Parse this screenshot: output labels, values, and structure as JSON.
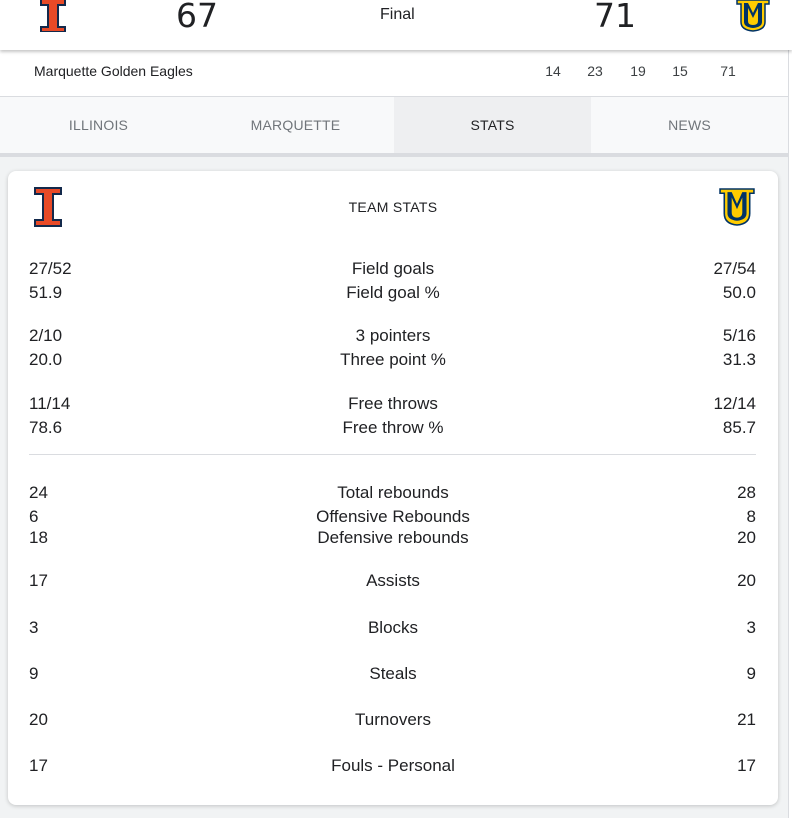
{
  "scoreboard": {
    "home_score": "67",
    "status": "Final",
    "away_score": "71"
  },
  "linescore": {
    "team": "Marquette Golden Eagles",
    "quarters": [
      "14",
      "23",
      "19",
      "15"
    ],
    "total": "71"
  },
  "tabs": [
    {
      "label": "ILLINOIS",
      "active": false
    },
    {
      "label": "MARQUETTE",
      "active": false
    },
    {
      "label": "STATS",
      "active": true
    },
    {
      "label": "NEWS",
      "active": false
    }
  ],
  "team_stats": {
    "title": "TEAM STATS",
    "rows": [
      {
        "label": "Field goals",
        "home": "27/52",
        "away": "27/54"
      },
      {
        "label": "Field goal %",
        "home": "51.9",
        "away": "50.0"
      },
      {
        "label": "3 pointers",
        "home": "2/10",
        "away": "5/16"
      },
      {
        "label": "Three point %",
        "home": "20.0",
        "away": "31.3"
      },
      {
        "label": "Free throws",
        "home": "11/14",
        "away": "12/14"
      },
      {
        "label": "Free throw %",
        "home": "78.6",
        "away": "85.7"
      },
      {
        "label": "Total rebounds",
        "home": "24",
        "away": "28"
      },
      {
        "label": "Offensive Rebounds",
        "home": "6",
        "away": "8"
      },
      {
        "label": "Defensive rebounds",
        "home": "18",
        "away": "20"
      },
      {
        "label": "Assists",
        "home": "17",
        "away": "20"
      },
      {
        "label": "Blocks",
        "home": "3",
        "away": "3"
      },
      {
        "label": "Steals",
        "home": "9",
        "away": "9"
      },
      {
        "label": "Turnovers",
        "home": "20",
        "away": "21"
      },
      {
        "label": "Fouls - Personal",
        "home": "17",
        "away": "17"
      }
    ]
  },
  "colors": {
    "illinois_orange": "#e84a27",
    "illinois_navy": "#13294b",
    "marquette_navy": "#003366",
    "marquette_gold": "#ffcc00"
  },
  "icons": {
    "home_logo": "illinois-block-i-icon",
    "away_logo": "marquette-mu-icon"
  }
}
